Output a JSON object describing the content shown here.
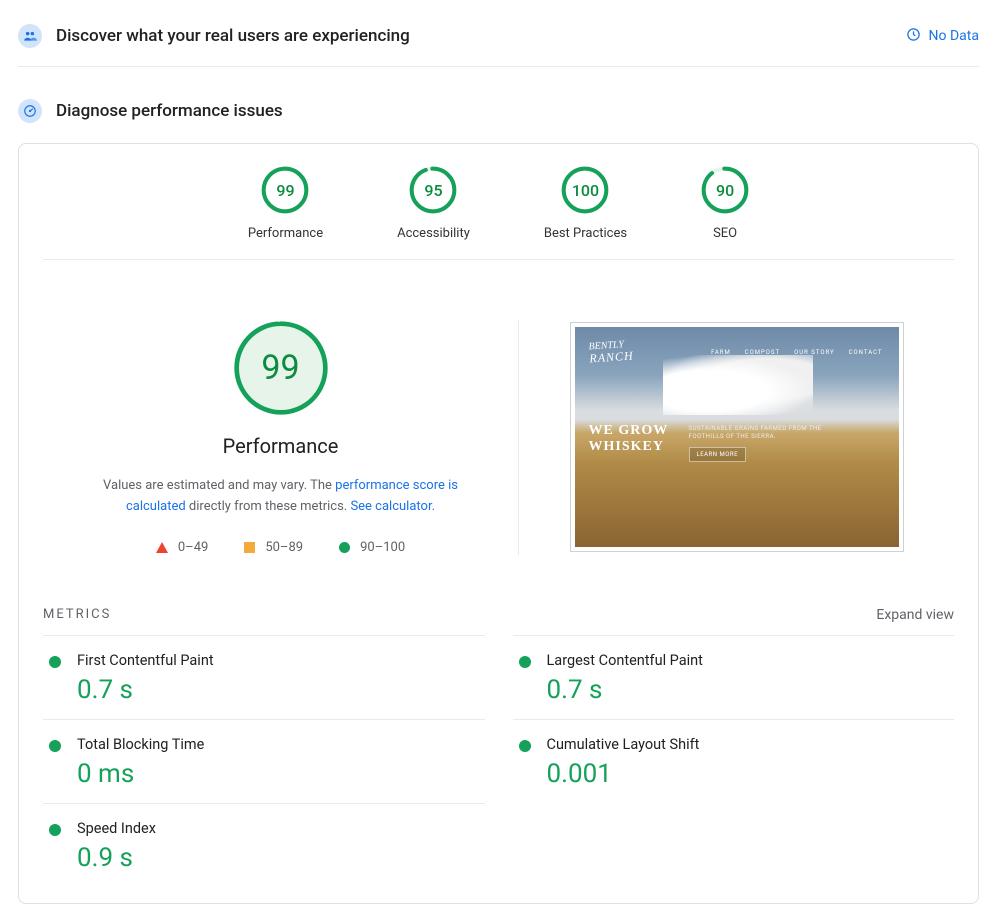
{
  "sections": {
    "discover_title": "Discover what your real users are experiencing",
    "no_data_label": "No Data",
    "diagnose_title": "Diagnose performance issues"
  },
  "gauges": [
    {
      "label": "Performance",
      "score": "99",
      "pct": 99
    },
    {
      "label": "Accessibility",
      "score": "95",
      "pct": 95
    },
    {
      "label": "Best Practices",
      "score": "100",
      "pct": 100
    },
    {
      "label": "SEO",
      "score": "90",
      "pct": 90
    }
  ],
  "performance": {
    "big_score": "99",
    "category_label": "Performance",
    "desc_prefix": "Values are estimated and may vary. The ",
    "desc_link1": "performance score is calculated",
    "desc_middle": " directly from these metrics. ",
    "desc_link2": "See calculator.",
    "legend": {
      "low": "0–49",
      "mid": "50–89",
      "high": "90–100"
    }
  },
  "screenshot": {
    "logo_line1": "BENTLY",
    "logo_line2": "RANCH",
    "nav": [
      "FARM",
      "COMPOST",
      "OUR STORY",
      "CONTACT"
    ],
    "hero_line1": "WE GROW",
    "hero_line2": "WHISKEY",
    "subhead": "SUSTAINABLE GRAINS FARMED FROM THE FOOTHILLS OF THE SIERRA.",
    "cta": "LEARN MORE"
  },
  "metrics_section": {
    "title": "METRICS",
    "expand": "Expand view"
  },
  "metrics": [
    {
      "name": "First Contentful Paint",
      "value": "0.7 s"
    },
    {
      "name": "Largest Contentful Paint",
      "value": "0.7 s"
    },
    {
      "name": "Total Blocking Time",
      "value": "0 ms"
    },
    {
      "name": "Cumulative Layout Shift",
      "value": "0.001"
    },
    {
      "name": "Speed Index",
      "value": "0.9 s"
    }
  ],
  "colors": {
    "good": "#0cce6b",
    "good_stroke": "#15a15a"
  }
}
